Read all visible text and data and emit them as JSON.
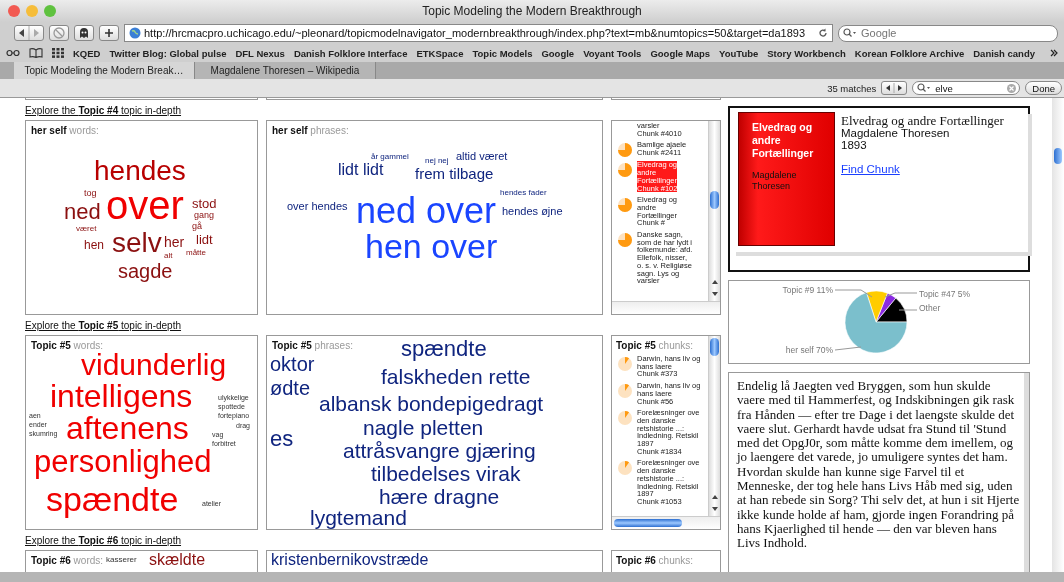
{
  "window": {
    "title": "Topic Modeling the Modern Breakthrough"
  },
  "toolbar": {
    "url": "http://hrcmacpro.uchicago.edu/~pleonard/topicmodelnavigator_modernbreakthrough/index.php?text=mb&numtopics=50&target=da1893",
    "search_placeholder": "Google"
  },
  "bookmarks": [
    "KQED",
    "Twitter Blog: Global pulse",
    "DFL Nexus",
    "Danish Folklore Interface",
    "ETKSpace",
    "Topic Models",
    "Google",
    "Voyant Tools",
    "Google Maps",
    "YouTube",
    "Story Workbench",
    "Korean Folklore Archive",
    "Danish candy"
  ],
  "tabs": [
    {
      "label": "Topic Modeling the Modern Break…",
      "selected": true
    },
    {
      "label": "Magdalene Thoresen – Wikipedia",
      "selected": false
    }
  ],
  "find_bar": {
    "matches": "35 matches",
    "query": "elve",
    "done": "Done"
  },
  "sections": [
    {
      "link": "Explore the **Topic #4** topic in-depth",
      "words": {
        "title": "**her self** words:",
        "items": [
          "hendes",
          "tog",
          "ned",
          "over",
          "stod",
          "gang",
          "været",
          "gå",
          "hen",
          "selv",
          "her",
          "lidt",
          "alt",
          "måtte",
          "sagde"
        ]
      },
      "phrases": {
        "title": "**her self** phrases:",
        "items": [
          "år gammel",
          "nej nej",
          "altid været",
          "lidt lidt",
          "frem tilbage",
          "hendes fader",
          "over hendes",
          "ned over",
          "hendes øjne",
          "hen over"
        ]
      },
      "chunks": {
        "items": [
          {
            "kind": "partial",
            "lines": [
              "varsler"
            ],
            "chunk": "Chunk #4010",
            "selected": false
          },
          {
            "kind": "item",
            "lines": [
              "Bamlige ajaele"
            ],
            "chunk": "Chunk #2411",
            "selected": false
          },
          {
            "kind": "item",
            "lines": [
              "Elvedrag og",
              "andre",
              "Fortællinger"
            ],
            "chunk": "Chunk #102",
            "selected": true
          },
          {
            "kind": "item",
            "lines": [
              "Elvedrag og",
              "andre",
              "Fortællinger"
            ],
            "chunk": "Chunk #",
            "selected": false
          },
          {
            "kind": "item",
            "lines": [
              "Danske sagn,",
              "som de har lydt i",
              "folkemunde: afd.",
              "Ellefolk, nisser,",
              "o. s. v. Religiøse",
              "sagn. Lys og",
              "varsler"
            ],
            "selected": false
          }
        ]
      }
    },
    {
      "link": "Explore the **Topic #5** topic in-depth",
      "words": {
        "title": "**Topic #5** words:",
        "items": [
          "vidunderlig",
          "intelligens",
          "ulykkelige",
          "spottede",
          "aen",
          "aftenens",
          "fortepiano",
          "ender",
          "drag",
          "skumring",
          "vag",
          "forbitret",
          "personlighed",
          "spændte",
          "atelier"
        ]
      },
      "phrases": {
        "title": "**Topic #5** phrases:",
        "items": [
          "spændte",
          "oktor",
          "falskheden rette",
          "ødte",
          "albansk bondepigedragt",
          "nagle pletten",
          "es",
          "attråsvangre gjæring",
          "tilbedelses virak",
          "hære dragne",
          "lygtemand"
        ]
      },
      "chunks": {
        "title": "**Topic #5** chunks:",
        "items": [
          {
            "kind": "item",
            "lines": [
              "Darwin, hans liv og",
              "hans laere"
            ],
            "chunk": "Chunk #373",
            "selected": false
          },
          {
            "kind": "item",
            "lines": [
              "Darwin, hans liv og",
              "hans laere"
            ],
            "chunk": "Chunk #56",
            "selected": false
          },
          {
            "kind": "item",
            "lines": [
              "Forelæsninger ove",
              "den danske",
              "retshistorie ...:",
              "Indledning. Retskil",
              "1897"
            ],
            "chunk": "Chunk #1834",
            "selected": false
          },
          {
            "kind": "item",
            "lines": [
              "Forelæsninger ove",
              "den danske",
              "retshistorie ...:",
              "Indledning. Retskil",
              "1897"
            ],
            "chunk": "Chunk #1053",
            "selected": false
          }
        ]
      }
    },
    {
      "link": "Explore the **Topic #6** topic in-depth",
      "words": {
        "title": "**Topic #6** words:",
        "items": [
          "kasserer",
          "skældte"
        ]
      },
      "phrases": {
        "items": [
          "kristenbernikovstræde"
        ]
      },
      "chunks": {
        "title": "**Topic #6** chunks:"
      }
    }
  ],
  "book": {
    "cover_title": "Elvedrag og andre Fortællinger",
    "cover_author": "Magdalene Thoresen",
    "title": "Elvedrag og andre Fortællinger",
    "author": "Magdalene Thoresen",
    "year": "1893",
    "link": "Find Chunk"
  },
  "pie": {
    "chart_data": {
      "type": "pie",
      "categories": [
        "Other",
        "Topic #47 5%",
        "Topic #9 11%",
        "her self 70%"
      ],
      "values": [
        14,
        5,
        11,
        70
      ],
      "colors": [
        "#000000",
        "#8a2be2",
        "#ffcc00",
        "#7bbfcc"
      ]
    }
  },
  "excerpt": "Endelig lå Jaegten ved Bryggen, som hun skulde vaere med til Hammerfest, og Indskibningen gik rask fra Hånden — efter tre Dage i det laengste skulde det vaere slut. Gerhardt havde udsat fra Stund til 'Stund med det OpgJ0r, som måtte komme dem imellem, og jo laengere det varede, jo umuligere syntes det ham. Hvordan skulde han kunne sige Farvel til et Menneske, der tog hele hans Livs Håb med sig, uden at han rebede sin Sorg? Thi selv det, at hun i sit Hjerte ikke kunde holde af ham, gjorde ingen Forandring på hans Kjaerlighed til hende — den var bleven hans Livs Indhold."
}
